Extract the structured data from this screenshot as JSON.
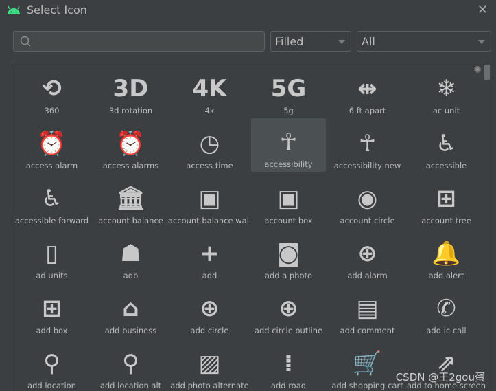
{
  "window": {
    "title": "Select Icon",
    "close_icon": "close-icon",
    "logo": "android-logo"
  },
  "toolbar": {
    "search_value": "",
    "search_icon": "search-icon",
    "style_select": "Filled",
    "category_select": "All"
  },
  "icons": [
    {
      "label": "360",
      "glyph": "⟲"
    },
    {
      "label": "3d rotation",
      "glyph": "3D"
    },
    {
      "label": "4k",
      "glyph": "4K"
    },
    {
      "label": "5g",
      "glyph": "5G"
    },
    {
      "label": "6 ft apart",
      "glyph": "⇹"
    },
    {
      "label": "ac unit",
      "glyph": "❄"
    },
    {
      "label": "access alarm",
      "glyph": "⏰"
    },
    {
      "label": "access alarms",
      "glyph": "⏰"
    },
    {
      "label": "access time",
      "glyph": "◷"
    },
    {
      "label": "accessibility",
      "glyph": "☥",
      "selected": true
    },
    {
      "label": "accessibility new",
      "glyph": "☥"
    },
    {
      "label": "accessible",
      "glyph": "♿"
    },
    {
      "label": "accessible forward",
      "glyph": "♿"
    },
    {
      "label": "account balance",
      "glyph": "🏛"
    },
    {
      "label": "account balance wall",
      "glyph": "▣"
    },
    {
      "label": "account box",
      "glyph": "▣"
    },
    {
      "label": "account circle",
      "glyph": "◉"
    },
    {
      "label": "account tree",
      "glyph": "⊞"
    },
    {
      "label": "ad units",
      "glyph": "▯"
    },
    {
      "label": "adb",
      "glyph": "☗"
    },
    {
      "label": "add",
      "glyph": "+"
    },
    {
      "label": "add a photo",
      "glyph": "◙"
    },
    {
      "label": "add alarm",
      "glyph": "⊕"
    },
    {
      "label": "add alert",
      "glyph": "🔔"
    },
    {
      "label": "add box",
      "glyph": "⊞"
    },
    {
      "label": "add business",
      "glyph": "⌂"
    },
    {
      "label": "add circle",
      "glyph": "⊕"
    },
    {
      "label": "add circle outline",
      "glyph": "⊕"
    },
    {
      "label": "add comment",
      "glyph": "▤"
    },
    {
      "label": "add ic call",
      "glyph": "✆"
    },
    {
      "label": "add location",
      "glyph": "⚲"
    },
    {
      "label": "add location alt",
      "glyph": "⚲"
    },
    {
      "label": "add photo alternate",
      "glyph": "▨"
    },
    {
      "label": "add road",
      "glyph": "⁞"
    },
    {
      "label": "add shopping cart",
      "glyph": "🛒"
    },
    {
      "label": "add to home screen",
      "glyph": "⇗"
    }
  ],
  "watermark": "CSDN @王2gou蛋"
}
